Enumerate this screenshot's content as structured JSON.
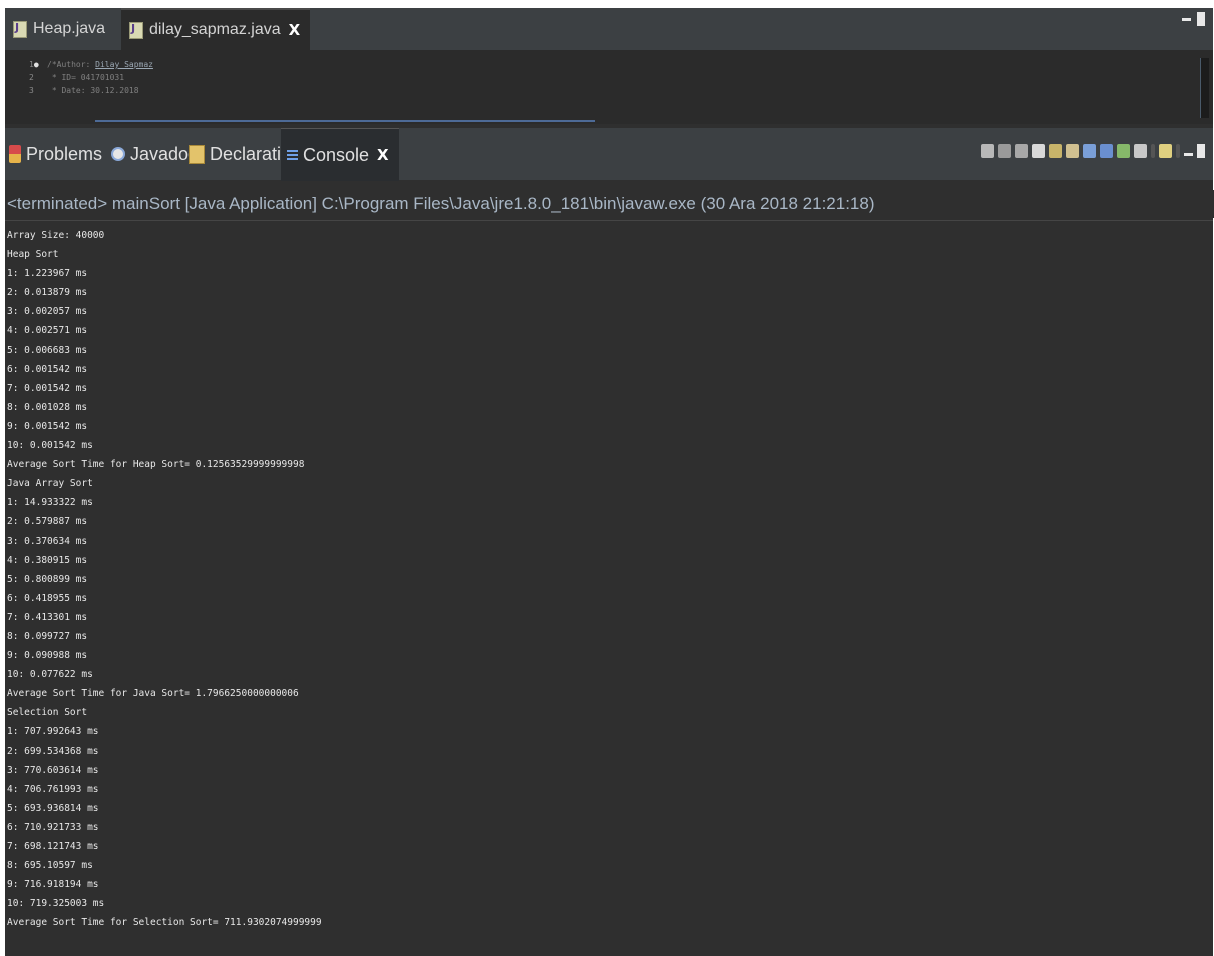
{
  "editor_tabs": [
    {
      "label": "Heap.java",
      "active": false
    },
    {
      "label": "dilay_sapmaz.java",
      "active": true,
      "closable": true
    }
  ],
  "editor": {
    "lines": [
      {
        "num": "1",
        "text": "/*Author: ",
        "underlined": "Dilay Sapmaz"
      },
      {
        "num": "2",
        "text": " * ID= 041701031",
        "underlined": ""
      },
      {
        "num": "3",
        "text": " * Date: 30.12.2018",
        "underlined": ""
      }
    ]
  },
  "panel_tabs": [
    {
      "label": "Problems",
      "icon": "problems-icon",
      "active": false
    },
    {
      "label": "Javadoc",
      "icon": "javadoc-icon",
      "active": false
    },
    {
      "label": "Declaration",
      "icon": "declaration-icon",
      "active": false
    },
    {
      "label": "Console",
      "icon": "console-icon",
      "active": true,
      "closable": true
    }
  ],
  "close_glyph": "X",
  "status": "<terminated> mainSort [Java Application] C:\\Program Files\\Java\\jre1.8.0_181\\bin\\javaw.exe (30 Ara 2018 21:21:18)",
  "console_output": [
    "Array Size: 40000",
    "Heap Sort",
    "1: 1.223967 ms",
    "2: 0.013879 ms",
    "3: 0.002057 ms",
    "4: 0.002571 ms",
    "5: 0.006683 ms",
    "6: 0.001542 ms",
    "7: 0.001542 ms",
    "8: 0.001028 ms",
    "9: 0.001542 ms",
    "10: 0.001542 ms",
    "Average Sort Time for Heap Sort= 0.12563529999999998",
    "Java Array Sort",
    "1: 14.933322 ms",
    "2: 0.579887 ms",
    "3: 0.370634 ms",
    "4: 0.380915 ms",
    "5: 0.800899 ms",
    "6: 0.418955 ms",
    "7: 0.413301 ms",
    "8: 0.099727 ms",
    "9: 0.090988 ms",
    "10: 0.077622 ms",
    "Average Sort Time for Java Sort= 1.7966250000000006",
    "Selection Sort",
    "1: 707.992643 ms",
    "2: 699.534368 ms",
    "3: 770.603614 ms",
    "4: 706.761993 ms",
    "5: 693.936814 ms",
    "6: 710.921733 ms",
    "7: 698.121743 ms",
    "8: 695.10597 ms",
    "9: 716.918194 ms",
    "10: 719.325003 ms",
    "Average Sort Time for Selection Sort= 711.9302074999999"
  ],
  "colors": {
    "background": "#2f2f2f",
    "tab_strip": "#3c4043",
    "status_text": "#a9b7c6",
    "output_text": "#e8e8e8"
  }
}
